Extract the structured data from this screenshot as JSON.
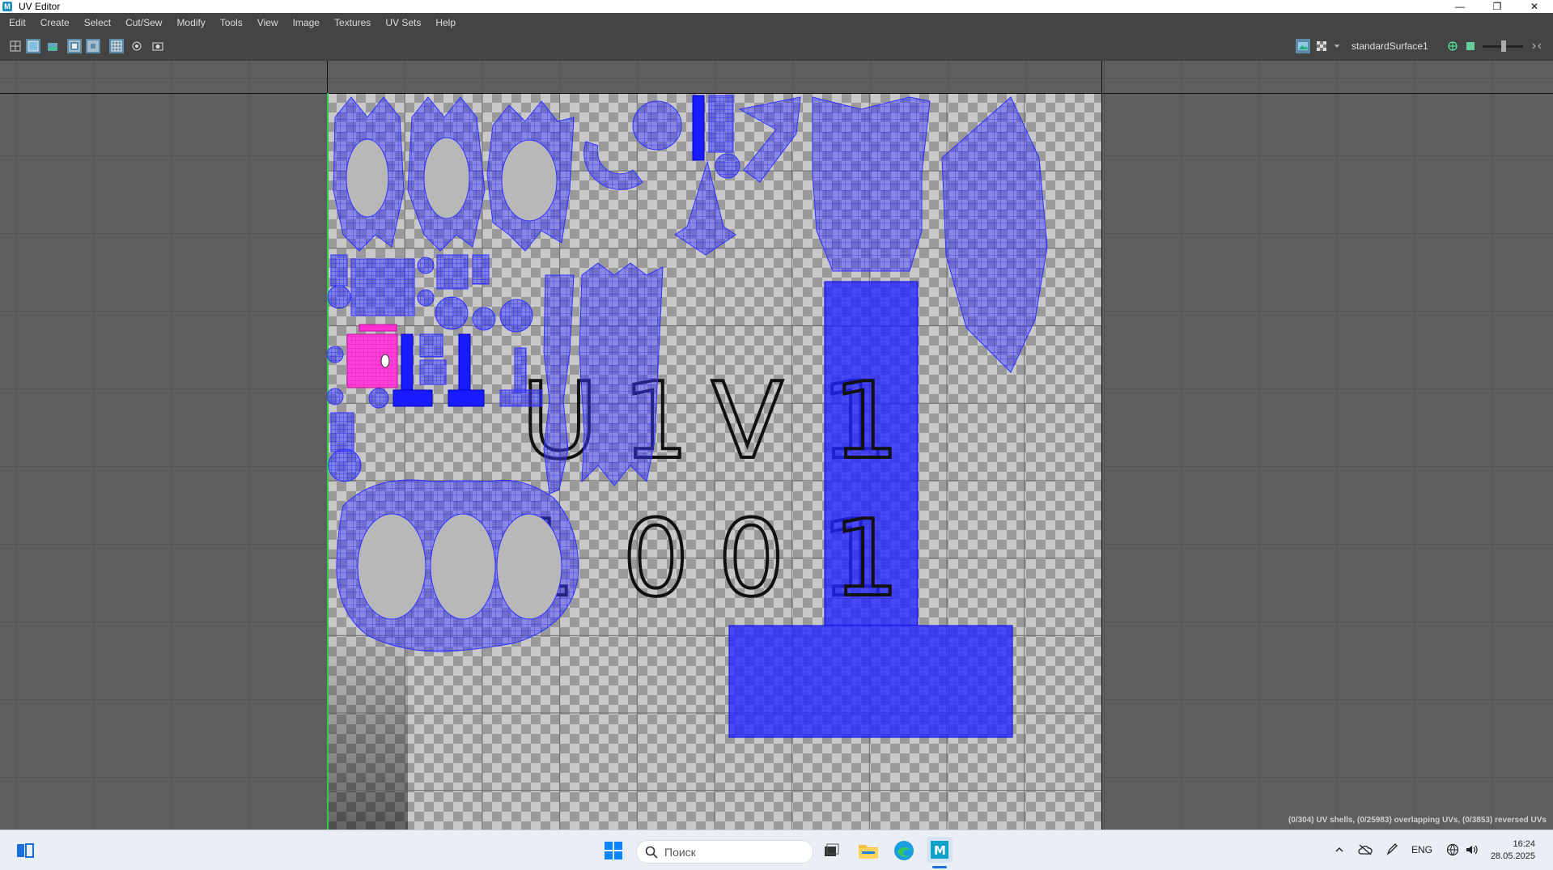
{
  "window": {
    "title": "UV Editor",
    "app_icon_letter": "M"
  },
  "win_controls": {
    "minimize": "—",
    "maximize": "❐",
    "close": "✕"
  },
  "menu": [
    "Edit",
    "Create",
    "Select",
    "Cut/Sew",
    "Modify",
    "Tools",
    "View",
    "Image",
    "Textures",
    "UV Sets",
    "Help"
  ],
  "toolbar": {
    "left_icons": [
      "uv-grid-icon",
      "shaded-uv-icon",
      "texture-image-icon",
      "tile-view-icon",
      "tile-view-alt-icon",
      "grid-toggle-icon",
      "isolate-icon",
      "snapshot-icon"
    ],
    "shader_name": "standardSurface1",
    "right_icons": [
      "image-display-icon",
      "checker-icon",
      "dropdown-icon",
      "exposure-icon",
      "color-icon",
      "gamma-slider",
      "arrows-icon"
    ]
  },
  "texture_labels": {
    "row1": [
      "U",
      "1",
      "V",
      "1"
    ],
    "row2": [
      "1",
      "0",
      "0",
      "1"
    ]
  },
  "status_text": "(0/304) UV shells, (0/25983) overlapping UVs, (0/3853) reversed UVs",
  "taskbar": {
    "search_placeholder": "Поиск",
    "tray_lang": "ENG",
    "time": "16:24",
    "date": "28.05.2025"
  },
  "colors": {
    "uv_fill": "#3a3aff",
    "uv_stroke": "#2020e8",
    "selected_shell": "#ff2bd0",
    "accent": "#5d8aa8"
  }
}
